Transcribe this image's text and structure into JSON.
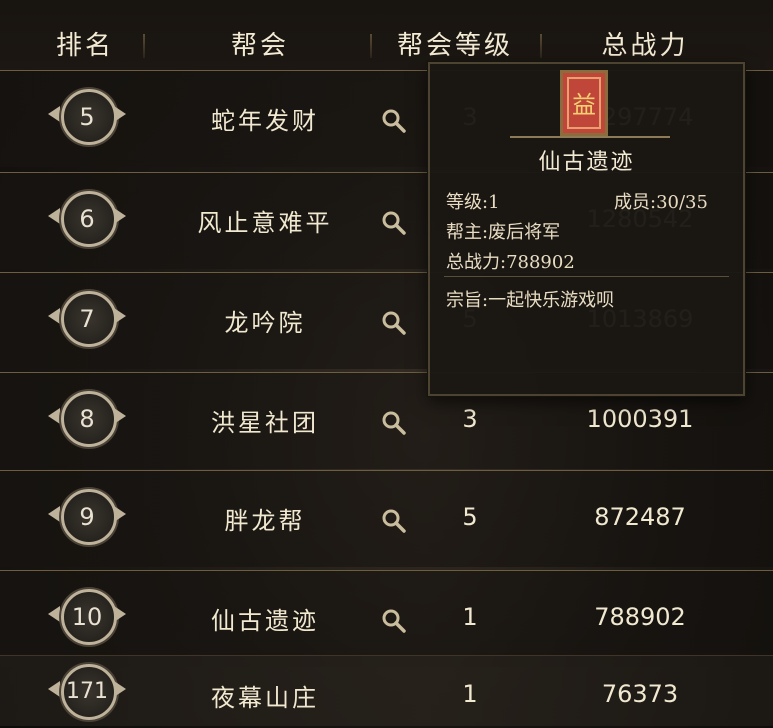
{
  "header": {
    "rank": "排名",
    "guild": "帮会",
    "level": "帮会等级",
    "power": "总战力"
  },
  "rows": [
    {
      "rank": "5",
      "name": "蛇年发财",
      "level": "3",
      "power": "1297774"
    },
    {
      "rank": "6",
      "name": "风止意难平",
      "level": "",
      "power": "1280542"
    },
    {
      "rank": "7",
      "name": "龙吟院",
      "level": "5",
      "power": "1013869"
    },
    {
      "rank": "8",
      "name": "洪星社团",
      "level": "3",
      "power": "1000391"
    },
    {
      "rank": "9",
      "name": "胖龙帮",
      "level": "5",
      "power": "872487"
    },
    {
      "rank": "10",
      "name": "仙古遗迹",
      "level": "1",
      "power": "788902"
    },
    {
      "rank": "171",
      "name": "夜幕山庄",
      "level": "1",
      "power": "76373"
    }
  ],
  "popup": {
    "emblem_char": "益",
    "title": "仙古遗迹",
    "level": "等级:1",
    "members": "成员:30/35",
    "leader": "帮主:废后将军",
    "power": "总战力:788902",
    "motto": "宗旨:一起快乐游戏呗"
  },
  "colors": {
    "accent_gold": "#bfb29a",
    "emblem_red": "#c0463a"
  }
}
